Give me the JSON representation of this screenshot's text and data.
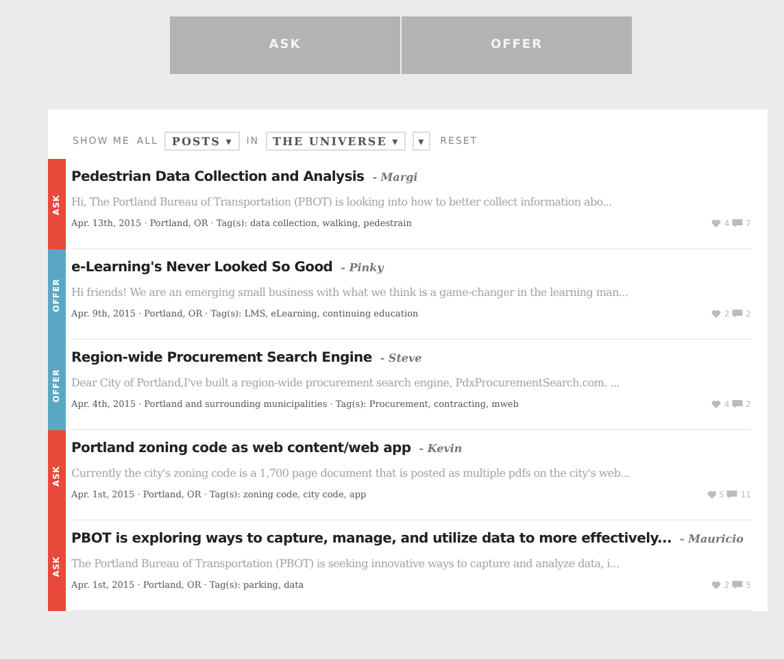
{
  "toggle": [
    {
      "label": "ASK",
      "selected": false
    },
    {
      "label": "OFFER",
      "selected": false
    }
  ],
  "filter": {
    "show_me": "SHOW ME",
    "all": "ALL",
    "type_select": "POSTS ▾",
    "in": "IN",
    "scope_select": "THE UNIVERSE ▾",
    "extra_select": "▾",
    "reset": "RESET"
  },
  "posts": [
    {
      "kind": "ask",
      "tag": "ASK",
      "title": "Pedestrian Data Collection and Analysis",
      "author": "- Margi",
      "excerpt": "Hi, The Portland Bureau of Transportation (PBOT) is looking into how to better collect information abo...",
      "meta": "Apr. 13th, 2015 · Portland, OR · Tag(s): data collection, walking, pedestrain",
      "likes": "4",
      "comments": "7"
    },
    {
      "kind": "offer",
      "tag": "OFFER",
      "title": "e-Learning's Never Looked So Good",
      "author": "- Pinky",
      "excerpt": "Hi friends! We are an emerging small business with what we think is a game-changer in the learning man...",
      "meta": "Apr. 9th, 2015 · Portland, OR · Tag(s): LMS, eLearning, continuing education",
      "likes": "2",
      "comments": "2"
    },
    {
      "kind": "offer",
      "tag": "OFFER",
      "title": "Region-wide Procurement Search Engine",
      "author": "- Steve",
      "excerpt": "Dear City of Portland,I've built a region-wide procurement search engine, PdxProcurementSearch.com. ...",
      "meta": "Apr. 4th, 2015 · Portland and surrounding municipalities · Tag(s): Procurement, contracting, mweb",
      "likes": "4",
      "comments": "2"
    },
    {
      "kind": "ask",
      "tag": "ASK",
      "title": "Portland zoning code as web content/web app",
      "author": "- Kevin",
      "excerpt": "Currently the city's zoning code is a 1,700 page document that is posted as multiple pdfs on the city's web...",
      "meta": "Apr. 1st, 2015 · Portland, OR · Tag(s): zoning code, city code, app",
      "likes": "5",
      "comments": "11"
    },
    {
      "kind": "ask",
      "tag": "ASK",
      "title": "PBOT is exploring ways to capture, manage, and utilize data to more effectively...",
      "author": "- Mauricio",
      "excerpt": "The Portland Bureau of Transportation (PBOT) is seeking innovative ways to capture and analyze data, i...",
      "meta": "Apr. 1st, 2015 · Portland, OR · Tag(s): parking, data",
      "likes": "2",
      "comments": "5"
    }
  ]
}
